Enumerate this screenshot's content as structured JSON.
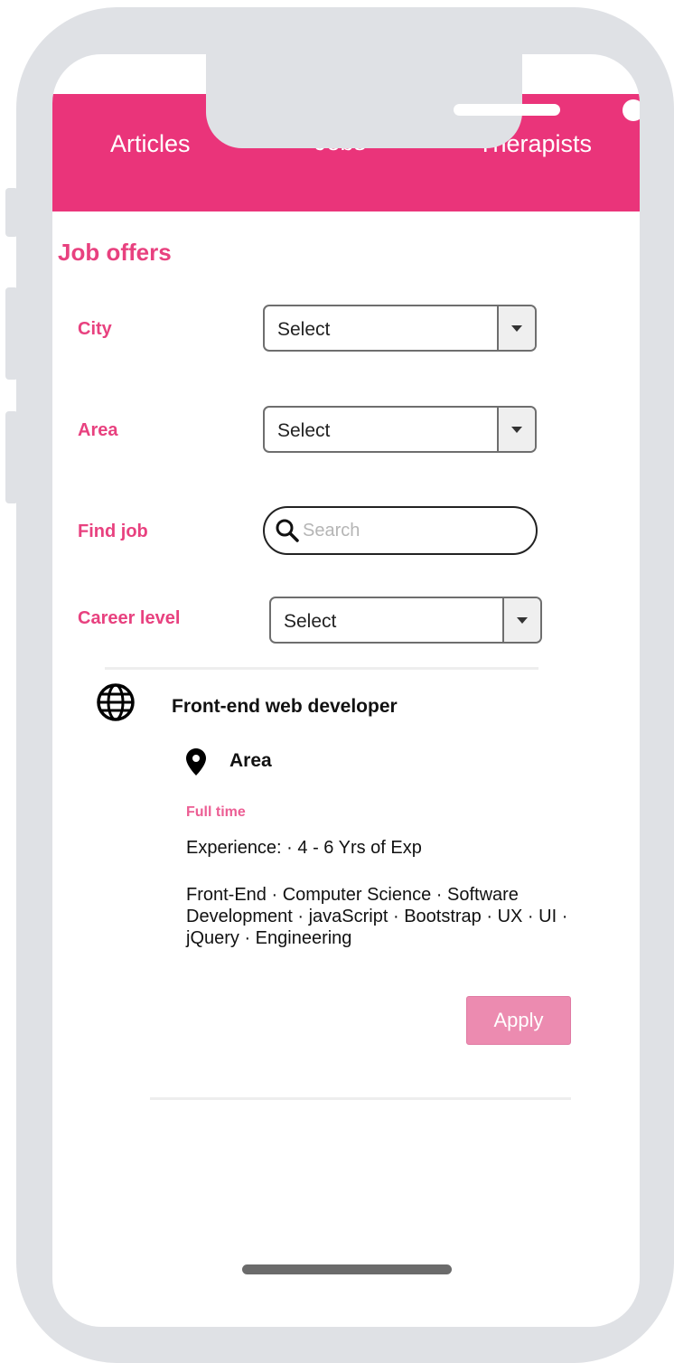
{
  "nav": {
    "tabs": [
      {
        "label": "Articles"
      },
      {
        "label": "Jobs",
        "active": true
      },
      {
        "label": "Therapists"
      }
    ]
  },
  "page": {
    "title": "Job offers"
  },
  "filters": {
    "city": {
      "label": "City",
      "value": "Select"
    },
    "area": {
      "label": "Area",
      "value": "Select"
    },
    "find_job": {
      "label": "Find job",
      "placeholder": "Search"
    },
    "career_level": {
      "label": "Career level",
      "value": "Select"
    }
  },
  "job": {
    "icon": "globe-icon",
    "title": "Front-end web developer",
    "location_icon": "map-pin-icon",
    "area": "Area",
    "type": "Full time",
    "experience": "Experience: · 4 - 6 Yrs of Exp",
    "tags": "Front-End · Computer Science · Software Development · javaScript · Bootstrap · UX · UI · jQuery · Engineering",
    "apply_label": "Apply"
  },
  "colors": {
    "accent": "#ea347a",
    "label": "#e8417f",
    "apply": "#ec8bb0",
    "frame": "#dfe1e5"
  }
}
